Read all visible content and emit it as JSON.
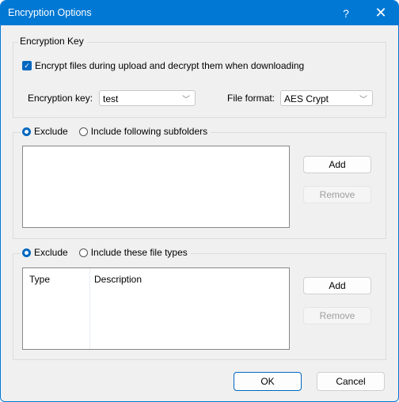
{
  "window": {
    "title": "Encryption Options",
    "help_glyph": "?",
    "close_glyph": "✕"
  },
  "encryption_key_group": {
    "title": "Encryption Key",
    "encrypt_checkbox": {
      "label": "Encrypt files during upload and decrypt them when downloading",
      "checked": true,
      "glyph": "✓"
    },
    "key_label": "Encryption key:",
    "key_value": "test",
    "format_label": "File format:",
    "format_value": "AES Crypt",
    "dropdown_glyph": "﹀"
  },
  "subfolders_group": {
    "radio_exclude": {
      "label": "Exclude",
      "selected": true
    },
    "radio_include": {
      "label": "Include following subfolders",
      "selected": false
    },
    "items": [],
    "add_label": "Add",
    "remove_label": "Remove"
  },
  "filetypes_group": {
    "radio_exclude": {
      "label": "Exclude",
      "selected": true
    },
    "radio_include": {
      "label": "Include these file types",
      "selected": false
    },
    "columns": [
      "Type",
      "Description"
    ],
    "rows": [],
    "add_label": "Add",
    "remove_label": "Remove"
  },
  "footer": {
    "ok_label": "OK",
    "cancel_label": "Cancel"
  }
}
